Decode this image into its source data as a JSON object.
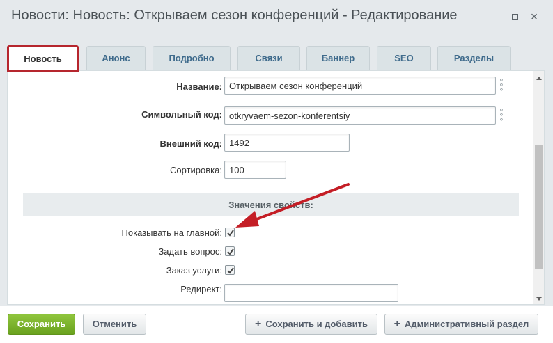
{
  "window": {
    "title": "Новости: Новость: Открываем сезон конференций - Редактирование",
    "maximize": "",
    "close": "×"
  },
  "tabs": [
    {
      "label": "Новость"
    },
    {
      "label": "Анонс"
    },
    {
      "label": "Подробно"
    },
    {
      "label": "Связи"
    },
    {
      "label": "Баннер"
    },
    {
      "label": "SEO"
    },
    {
      "label": "Разделы"
    }
  ],
  "form": {
    "name_label": "Название:",
    "name_value": "Открываем сезон конференций",
    "code_label": "Символьный код:",
    "code_value": "otkryvaem-sezon-konferentsiy",
    "ext_label": "Внешний код:",
    "ext_value": "1492",
    "sort_label": "Сортировка:",
    "sort_value": "100",
    "section_title": "Значения свойств:",
    "show_main_label": "Показывать на главной:",
    "show_main_checked": true,
    "ask_label": "Задать вопрос:",
    "ask_checked": true,
    "order_label": "Заказ услуги:",
    "order_checked": true,
    "redirect_label": "Редирект:",
    "redirect_value": ""
  },
  "footer": {
    "save": "Сохранить",
    "cancel": "Отменить",
    "save_add": "Сохранить и добавить",
    "admin": "Административный раздел"
  },
  "colors": {
    "active_tab_border": "#b6262e",
    "save_button": "#7ab32e",
    "annotation_arrow": "#c41e26"
  }
}
